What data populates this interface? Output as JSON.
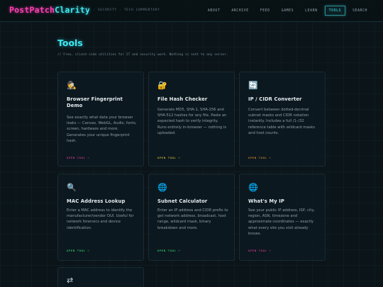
{
  "header": {
    "logo_part1": "PostPatch",
    "logo_part2": "Clarity",
    "tagline": "IT · SECURITY · TECH COMMENTARY",
    "nav": [
      {
        "label": "ABOUT"
      },
      {
        "label": "ARCHIVE"
      },
      {
        "label": "FEED"
      },
      {
        "label": "GAMES"
      },
      {
        "label": "LEARN"
      },
      {
        "label": "TOOLS",
        "active": true
      },
      {
        "label": "SEARCH"
      }
    ]
  },
  "main": {
    "title": "Tools",
    "subtitle": "// Free, client-side utilities for IT and security work. Nothing is sent to any server.",
    "cards": [
      {
        "icon": "detective-icon",
        "icon_glyph": "🕵",
        "title": "Browser Fingerprint Demo",
        "description": "See exactly what data your browser leaks — Canvas, WebGL, Audio, fonts, screen, hardware and more. Generates your unique fingerprint hash.",
        "link": "OPEN TOOL →",
        "link_color": "#ff3fb4"
      },
      {
        "icon": "lock-icon",
        "icon_glyph": "🔐",
        "title": "File Hash Checker",
        "description": "Generate MD5, SHA-1, SHA-256 and SHA-512 hashes for any file. Paste an expected hash to verify integrity. Runs entirely in-browser — nothing is uploaded.",
        "link": "OPEN TOOL →",
        "link_color": "#f0d43a"
      },
      {
        "icon": "refresh-icon",
        "icon_glyph": "🔄",
        "title": "IP / CIDR Converter",
        "description": "Convert between dotted-decimal subnet masks and CIDR notation instantly. Includes a full /1–/32 reference table with wildcard masks and host counts.",
        "link": "OPEN TOOL →",
        "link_color": "#ff9c3a"
      },
      {
        "icon": "magnifier-icon",
        "icon_glyph": "🔍",
        "title": "MAC Address Lookup",
        "description": "Enter a MAC address to identify the manufacturer/vendor OUI. Useful for network forensics and device identification.",
        "link": "OPEN TOOL →",
        "link_color": "#3ef07a"
      },
      {
        "icon": "globe-icon",
        "icon_glyph": "🌐",
        "title": "Subnet Calculator",
        "description": "Enter an IP address and CIDR prefix to get network address, broadcast, host range, wildcard mask, binary breakdown and more.",
        "link": "OPEN TOOL →",
        "link_color": "#3ef07a"
      },
      {
        "icon": "globe-icon",
        "icon_glyph": "🌐",
        "title": "What's My IP",
        "description": "See your public IP address, ISP, city, region, ASN, timezone and approximate coordinates — exactly what every site you visit already knows.",
        "link": "OPEN TOOL →",
        "link_color": "#ff3fb4"
      },
      {
        "icon": "arrows-icon",
        "icon_glyph": "⇄",
        "title": "",
        "description": "",
        "link": "",
        "link_color": "#3ee8f0"
      }
    ]
  }
}
